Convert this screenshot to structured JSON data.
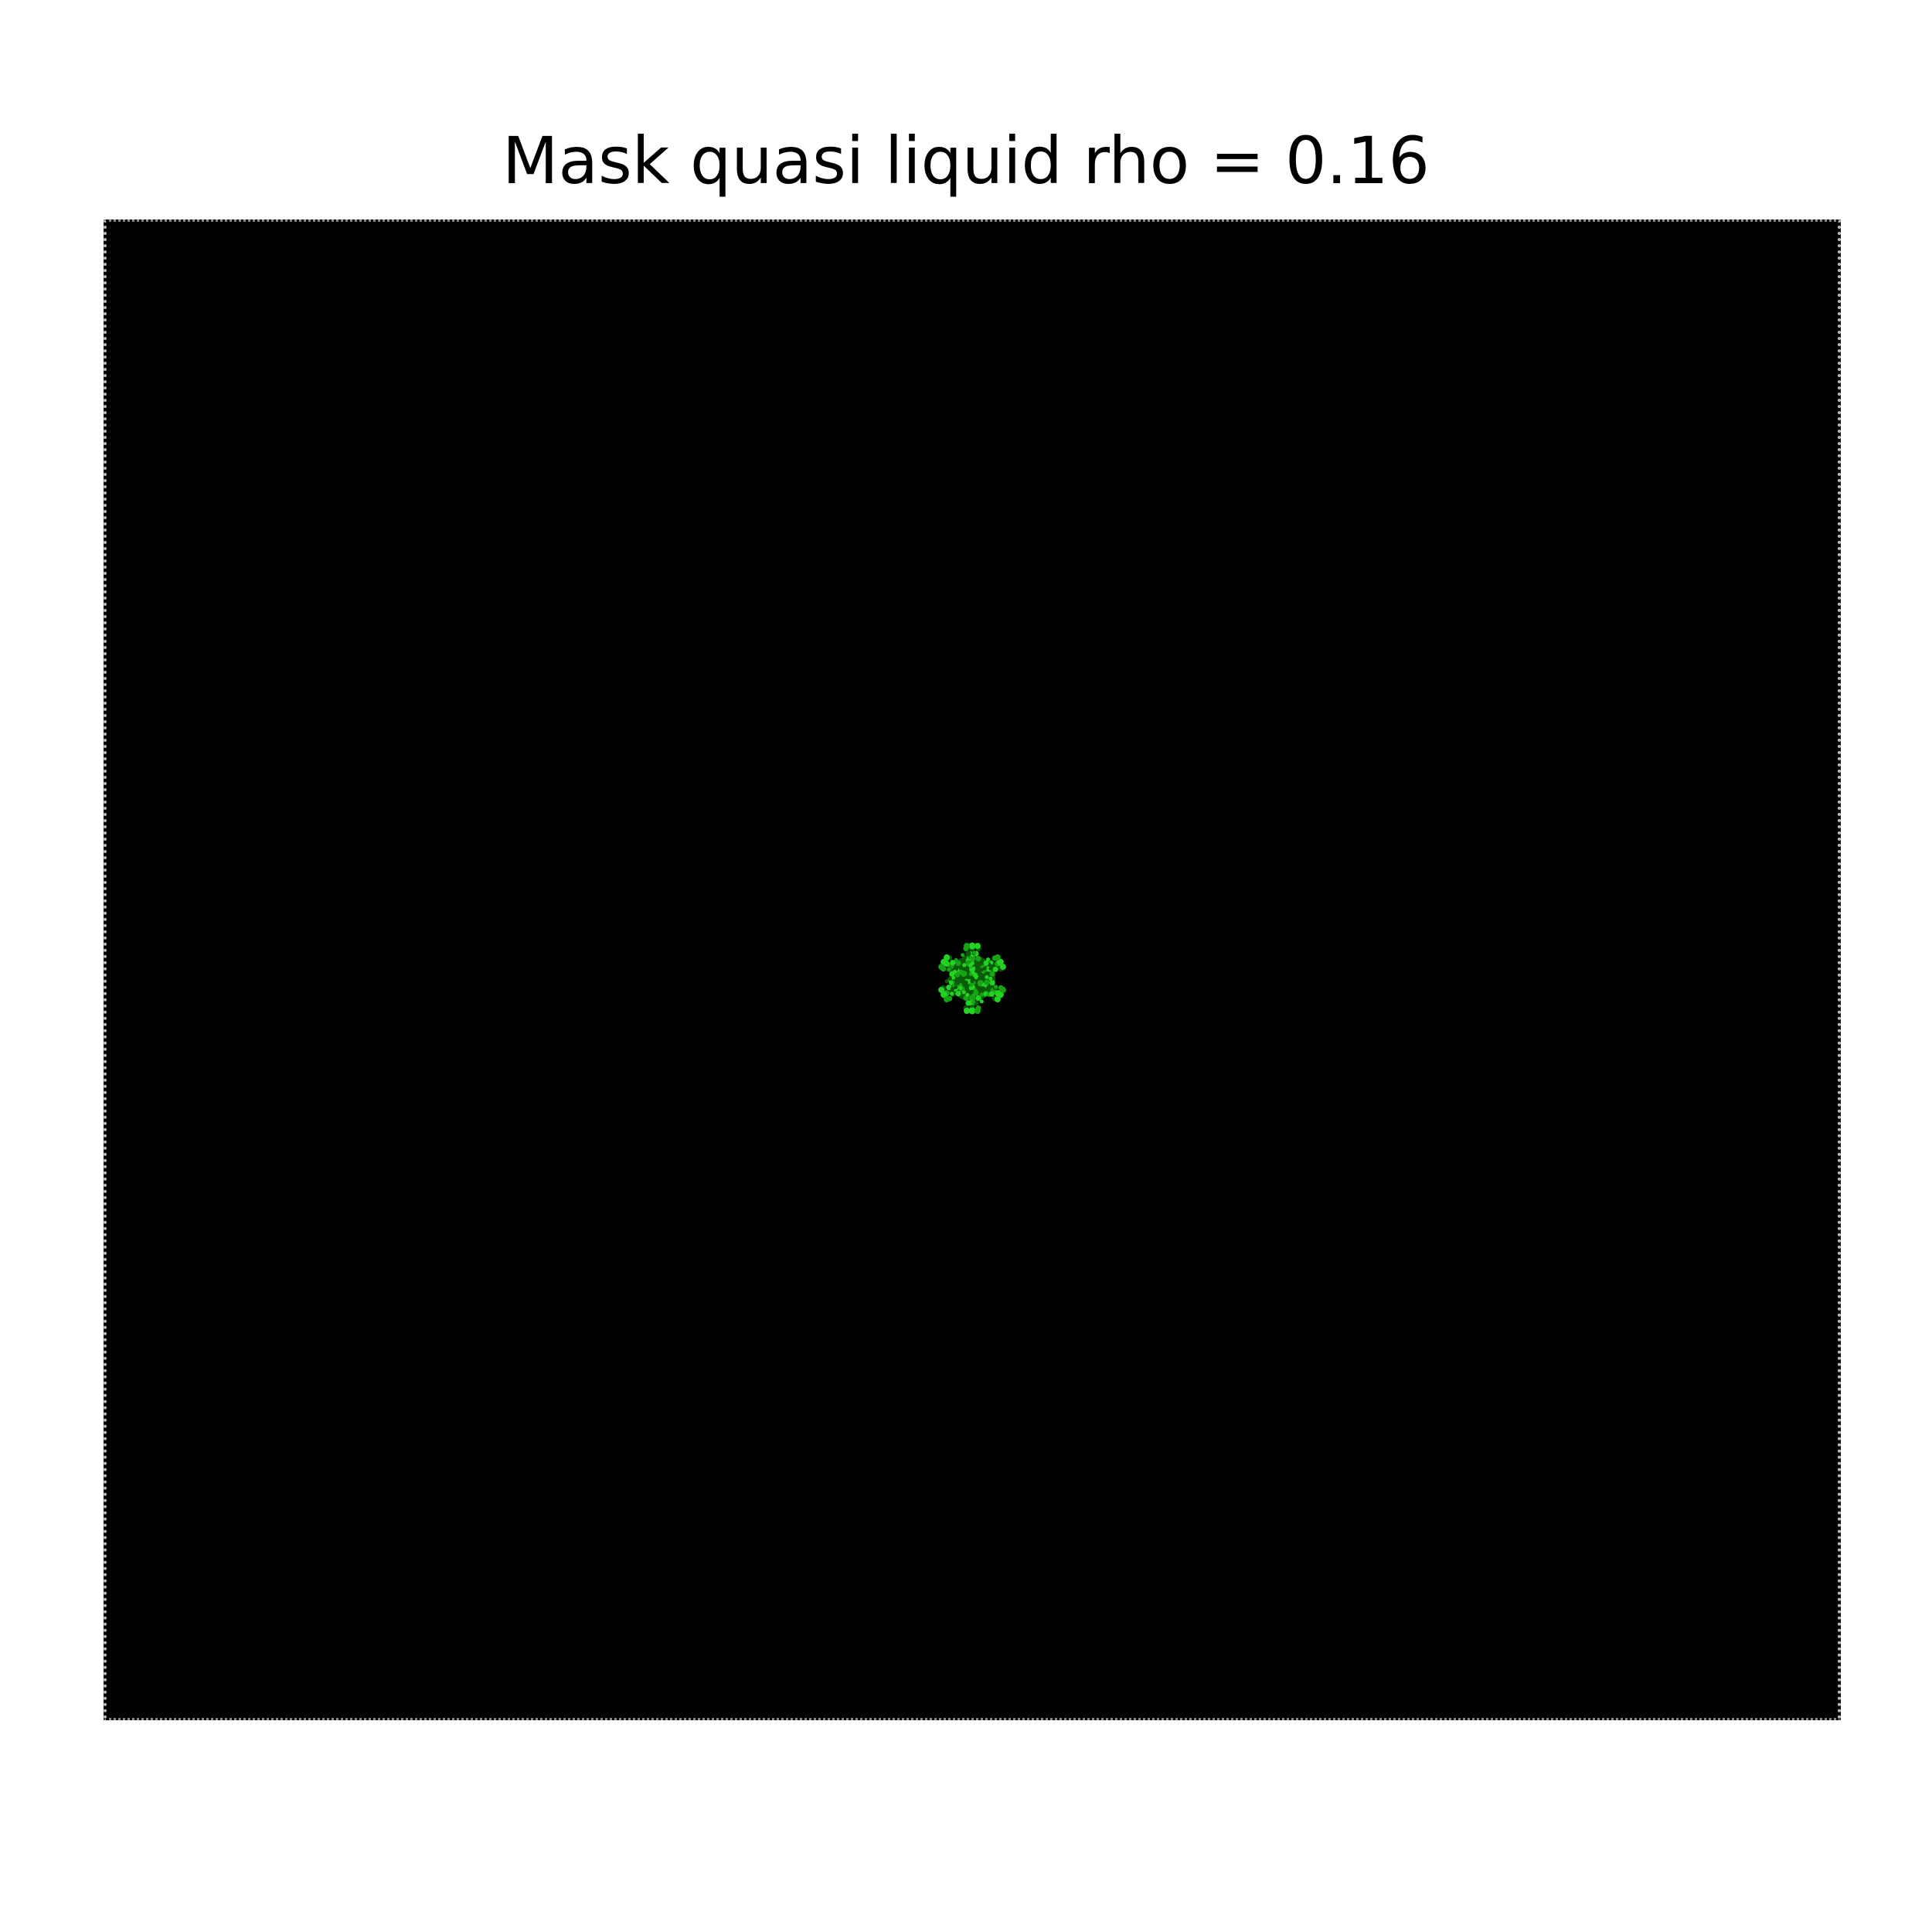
{
  "figure": {
    "title": "Mask quasi liquid rho = 0.16"
  },
  "colors": {
    "background": "#000000",
    "page": "#ffffff",
    "mask_bright": "#22d322",
    "mask_mid": "#16a316",
    "mask_dark": "#0a5a0a",
    "edge_dots": "#bdbdbd"
  },
  "cluster": {
    "description_color_levels": [
      "bright",
      "mid",
      "dark"
    ],
    "arms": 6
  }
}
